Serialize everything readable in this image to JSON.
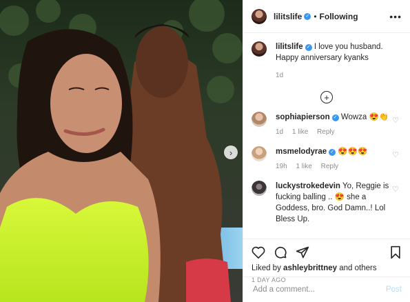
{
  "post": {
    "author": "lilitslife",
    "following_label": "Following",
    "separator": "•",
    "caption_user": "lilitslife",
    "caption_text": "I love you husband. Happy anniversary kyanks",
    "caption_time": "1d",
    "more_icon": "ellipsis-icon",
    "next_icon": "chevron-right-icon"
  },
  "comments": [
    {
      "user": "sophiapierson",
      "verified": true,
      "text": "Wowza 😍👏",
      "time": "1d",
      "likes": "1 like",
      "reply": "Reply"
    },
    {
      "user": "msmelodyrae",
      "verified": true,
      "text": "😍😍😍",
      "time": "19h",
      "likes": "1 like",
      "reply": "Reply"
    },
    {
      "user": "luckystrokedevin",
      "verified": false,
      "text": "Yo, Reggie is fucking balling .. 😍 she a Goddess, bro. God Damn..! Lol Bless Up.",
      "time": "",
      "likes": "",
      "reply": ""
    }
  ],
  "actions": {
    "liked_prefix": "Liked by",
    "liked_user": "ashleybrittney",
    "liked_suffix": "and others",
    "time_ago": "1 DAY AGO"
  },
  "add_comment": {
    "placeholder": "Add a comment...",
    "post_label": "Post"
  },
  "colors": {
    "verified": "#3897f0",
    "post_disabled": "#b2dffc",
    "meta_gray": "#8e8e8e"
  }
}
